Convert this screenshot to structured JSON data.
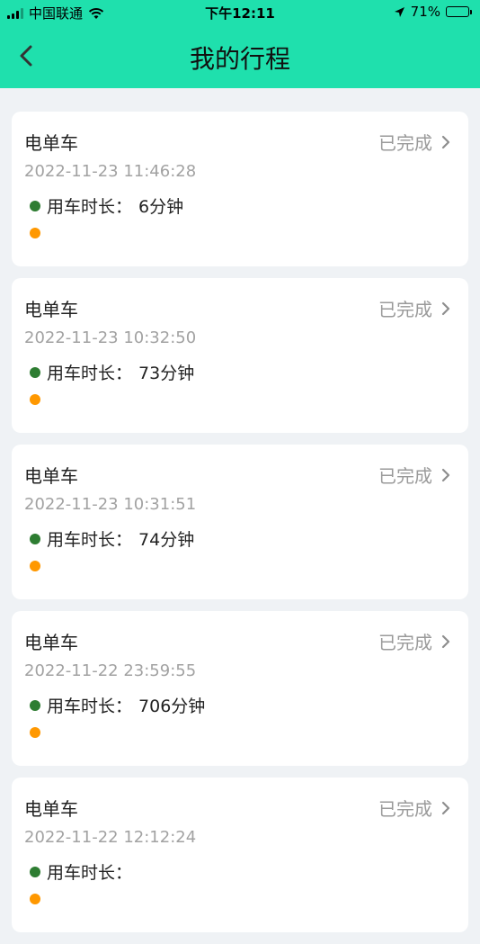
{
  "status_bar": {
    "carrier": "中国联通",
    "time": "下午12:11",
    "battery_percent": "71%",
    "battery_level": 0.71,
    "icons": [
      "signal-icon",
      "wifi-icon",
      "location-arrow-icon",
      "battery-icon"
    ]
  },
  "header": {
    "title": "我的行程",
    "back_icon": "chevron-left-icon",
    "background": "#1fe0ad"
  },
  "trips": [
    {
      "type": "电单车",
      "status": "已完成",
      "time": "2022-11-23 11:46:28",
      "duration_label": "用车时长：",
      "duration": "6分钟"
    },
    {
      "type": "电单车",
      "status": "已完成",
      "time": "2022-11-23 10:32:50",
      "duration_label": "用车时长：",
      "duration": "73分钟"
    },
    {
      "type": "电单车",
      "status": "已完成",
      "time": "2022-11-23 10:31:51",
      "duration_label": "用车时长：",
      "duration": "74分钟"
    },
    {
      "type": "电单车",
      "status": "已完成",
      "time": "2022-11-22 23:59:55",
      "duration_label": "用车时长：",
      "duration": "706分钟"
    },
    {
      "type": "电单车",
      "status": "已完成",
      "time": "2022-11-22 12:12:24",
      "duration_label": "用车时长：",
      "duration": ""
    }
  ],
  "colors": {
    "start_dot": "#2e7d32",
    "end_dot": "#ff9800",
    "status_text": "#9a9a9a"
  }
}
